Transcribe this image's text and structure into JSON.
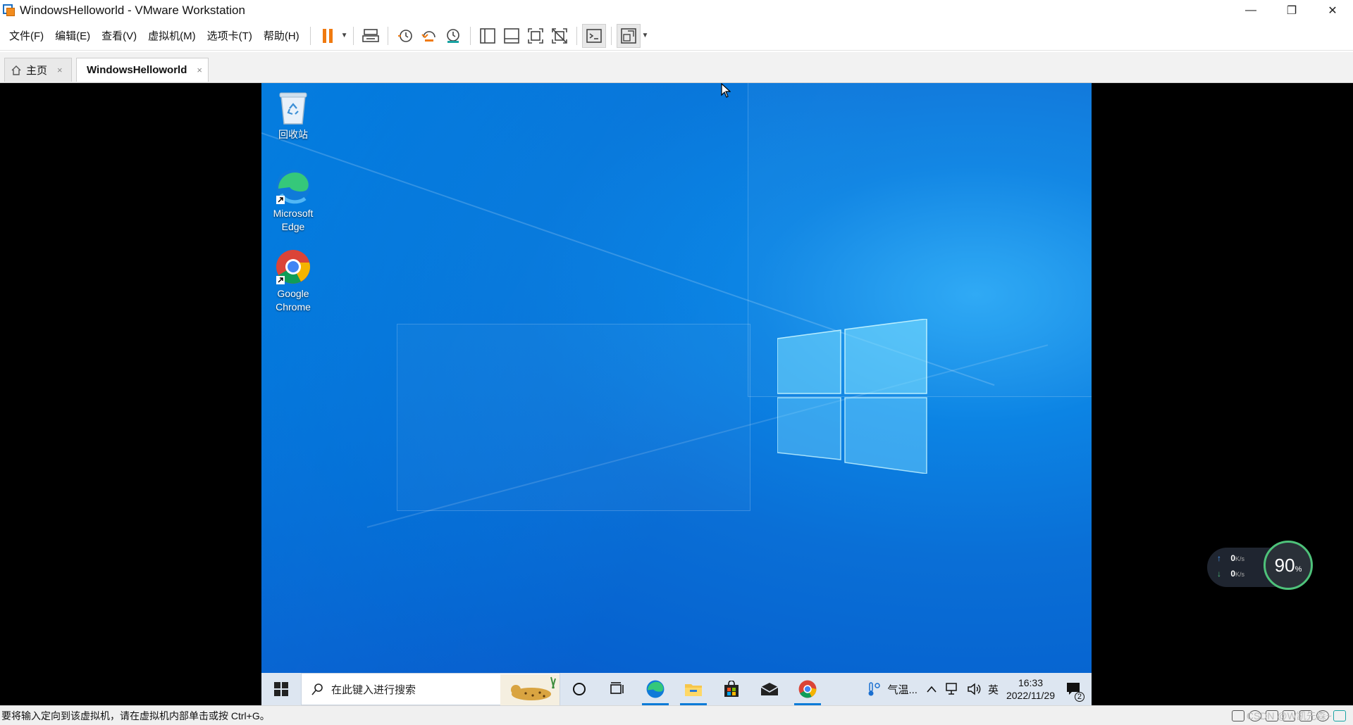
{
  "window": {
    "title": "WindowsHelloworld - VMware Workstation",
    "minimize": "—",
    "restore": "❐",
    "close": "✕"
  },
  "menu": {
    "items": [
      "文件(F)",
      "编辑(E)",
      "查看(V)",
      "虚拟机(M)",
      "选项卡(T)",
      "帮助(H)"
    ]
  },
  "tabs": [
    {
      "label": "主页",
      "close": "×"
    },
    {
      "label": "WindowsHelloworld",
      "close": "×"
    }
  ],
  "desktop": {
    "icons": [
      {
        "label_line1": "回收站",
        "label_line2": ""
      },
      {
        "label_line1": "Microsoft",
        "label_line2": "Edge"
      },
      {
        "label_line1": "Google",
        "label_line2": "Chrome"
      }
    ]
  },
  "taskbar": {
    "search_placeholder": "在此键入进行搜索",
    "weather": "气温...",
    "lang": "英",
    "time": "16:33",
    "date": "2022/11/29",
    "notification_count": "2"
  },
  "speed_widget": {
    "up": "0",
    "down": "0",
    "unit": "K/s",
    "percent": "90",
    "percent_sign": "%"
  },
  "statusbar": {
    "text": "要将输入定向到该虚拟机，请在虚拟机内部单击或按 Ctrl+G。",
    "watermark": "CSDN @W凯先森~"
  },
  "colors": {
    "accent_pause": "#f07a10",
    "desktop_blue": "#0a6fd6",
    "taskbar_bg": "#dde6f1"
  }
}
